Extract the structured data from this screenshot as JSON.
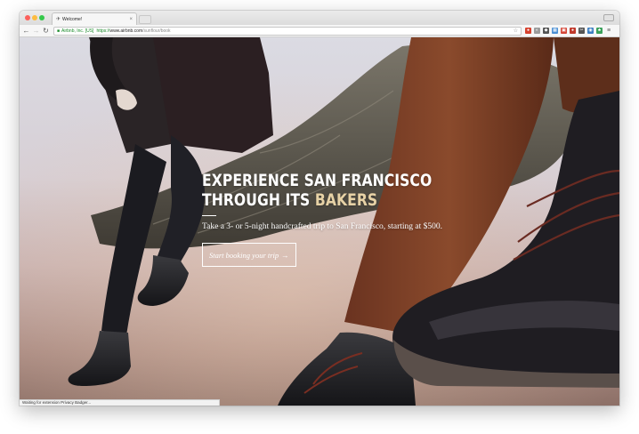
{
  "browser": {
    "tab_title": "Welcome!",
    "tab_close": "×",
    "url": {
      "cert": "Airbnb, Inc. [US]",
      "scheme": "https://",
      "host": "www.airbnb.com",
      "path": "/sunflour/book"
    },
    "extensions": [
      {
        "name": "privacy-badger-icon",
        "color": "#d6412e",
        "glyph": "●"
      },
      {
        "name": "adblock-icon",
        "color": "#9b9b9b",
        "glyph": "◐"
      },
      {
        "name": "pocket-icon",
        "color": "#555555",
        "glyph": "◆"
      },
      {
        "name": "grid-icon",
        "color": "#4a8fd4",
        "glyph": "▦"
      },
      {
        "name": "gmail-icon",
        "color": "#d44638",
        "glyph": "▣"
      },
      {
        "name": "lastpass-icon",
        "color": "#c0392b",
        "glyph": "●"
      },
      {
        "name": "scissors-icon",
        "color": "#555555",
        "glyph": "✂"
      },
      {
        "name": "ghostery-icon",
        "color": "#3c7ec2",
        "glyph": "◉"
      },
      {
        "name": "leaf-icon",
        "color": "#3aa05a",
        "glyph": "♣"
      }
    ],
    "status_text": "Waiting for extension Privacy Badger..."
  },
  "hero": {
    "headline_line1": "EXPERIENCE SAN FRANCISCO",
    "headline_line2_prefix": "THROUGH ITS ",
    "headline_line2_accent": "BAKERS",
    "subtitle": "Take a 3- or 5-night handcrafted trip to San Francisco, starting at $500.",
    "cta_label": "Start booking your trip",
    "cta_arrow": "→",
    "accent_color": "#e7d2a6"
  }
}
